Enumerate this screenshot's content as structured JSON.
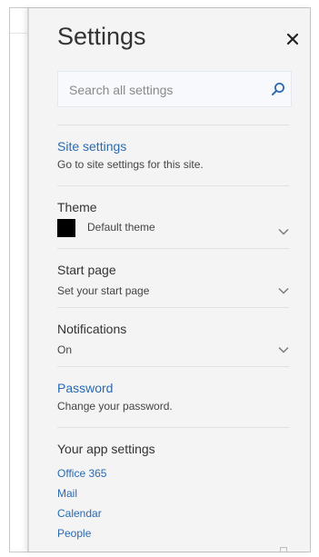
{
  "panel": {
    "title": "Settings",
    "search": {
      "placeholder": "Search all settings"
    }
  },
  "site_settings": {
    "label": "Site settings",
    "description": "Go to site settings for this site."
  },
  "theme": {
    "label": "Theme",
    "value": "Default theme",
    "swatch_color": "#000000"
  },
  "start_page": {
    "label": "Start page",
    "value": "Set your start page"
  },
  "notifications": {
    "label": "Notifications",
    "value": "On"
  },
  "password": {
    "label": "Password",
    "description": "Change your password."
  },
  "app_settings": {
    "label": "Your app settings",
    "links": [
      "Office 365",
      "Mail",
      "Calendar",
      "People"
    ]
  },
  "colors": {
    "link": "#2a6ab0",
    "panel_bg": "#f4f4f4",
    "text": "#333333"
  }
}
